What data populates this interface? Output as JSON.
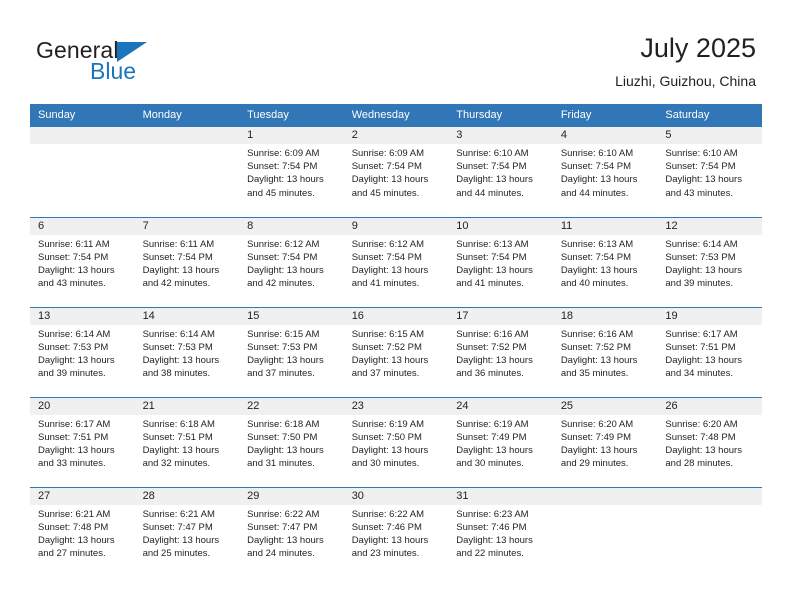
{
  "brand": {
    "name_top": "General",
    "name_bottom": "Blue",
    "triangle_icon": "blue-triangle-logo-icon",
    "color_primary": "#1b75bc",
    "color_text": "#231f20"
  },
  "header": {
    "title": "July 2025",
    "subtitle": "Liuzhi, Guizhou, China"
  },
  "theme": {
    "header_row_bg": "#3176b6",
    "date_band_bg": "#f0f0f0",
    "grid_line": "#3176b6",
    "page_bg": "#ffffff"
  },
  "weekday_headers": [
    "Sunday",
    "Monday",
    "Tuesday",
    "Wednesday",
    "Thursday",
    "Friday",
    "Saturday"
  ],
  "labels": {
    "sunrise_prefix": "Sunrise:",
    "sunset_prefix": "Sunset:",
    "daylight_prefix": "Daylight:"
  },
  "weeks": [
    [
      {
        "date": "",
        "empty": true,
        "sunrise": "",
        "sunset": "",
        "daylight_line1": "",
        "daylight_line2": ""
      },
      {
        "date": "",
        "empty": true,
        "sunrise": "",
        "sunset": "",
        "daylight_line1": "",
        "daylight_line2": ""
      },
      {
        "date": "1",
        "empty": false,
        "sunrise": "Sunrise: 6:09 AM",
        "sunset": "Sunset: 7:54 PM",
        "daylight_line1": "Daylight: 13 hours",
        "daylight_line2": "and 45 minutes."
      },
      {
        "date": "2",
        "empty": false,
        "sunrise": "Sunrise: 6:09 AM",
        "sunset": "Sunset: 7:54 PM",
        "daylight_line1": "Daylight: 13 hours",
        "daylight_line2": "and 45 minutes."
      },
      {
        "date": "3",
        "empty": false,
        "sunrise": "Sunrise: 6:10 AM",
        "sunset": "Sunset: 7:54 PM",
        "daylight_line1": "Daylight: 13 hours",
        "daylight_line2": "and 44 minutes."
      },
      {
        "date": "4",
        "empty": false,
        "sunrise": "Sunrise: 6:10 AM",
        "sunset": "Sunset: 7:54 PM",
        "daylight_line1": "Daylight: 13 hours",
        "daylight_line2": "and 44 minutes."
      },
      {
        "date": "5",
        "empty": false,
        "sunrise": "Sunrise: 6:10 AM",
        "sunset": "Sunset: 7:54 PM",
        "daylight_line1": "Daylight: 13 hours",
        "daylight_line2": "and 43 minutes."
      }
    ],
    [
      {
        "date": "6",
        "empty": false,
        "sunrise": "Sunrise: 6:11 AM",
        "sunset": "Sunset: 7:54 PM",
        "daylight_line1": "Daylight: 13 hours",
        "daylight_line2": "and 43 minutes."
      },
      {
        "date": "7",
        "empty": false,
        "sunrise": "Sunrise: 6:11 AM",
        "sunset": "Sunset: 7:54 PM",
        "daylight_line1": "Daylight: 13 hours",
        "daylight_line2": "and 42 minutes."
      },
      {
        "date": "8",
        "empty": false,
        "sunrise": "Sunrise: 6:12 AM",
        "sunset": "Sunset: 7:54 PM",
        "daylight_line1": "Daylight: 13 hours",
        "daylight_line2": "and 42 minutes."
      },
      {
        "date": "9",
        "empty": false,
        "sunrise": "Sunrise: 6:12 AM",
        "sunset": "Sunset: 7:54 PM",
        "daylight_line1": "Daylight: 13 hours",
        "daylight_line2": "and 41 minutes."
      },
      {
        "date": "10",
        "empty": false,
        "sunrise": "Sunrise: 6:13 AM",
        "sunset": "Sunset: 7:54 PM",
        "daylight_line1": "Daylight: 13 hours",
        "daylight_line2": "and 41 minutes."
      },
      {
        "date": "11",
        "empty": false,
        "sunrise": "Sunrise: 6:13 AM",
        "sunset": "Sunset: 7:54 PM",
        "daylight_line1": "Daylight: 13 hours",
        "daylight_line2": "and 40 minutes."
      },
      {
        "date": "12",
        "empty": false,
        "sunrise": "Sunrise: 6:14 AM",
        "sunset": "Sunset: 7:53 PM",
        "daylight_line1": "Daylight: 13 hours",
        "daylight_line2": "and 39 minutes."
      }
    ],
    [
      {
        "date": "13",
        "empty": false,
        "sunrise": "Sunrise: 6:14 AM",
        "sunset": "Sunset: 7:53 PM",
        "daylight_line1": "Daylight: 13 hours",
        "daylight_line2": "and 39 minutes."
      },
      {
        "date": "14",
        "empty": false,
        "sunrise": "Sunrise: 6:14 AM",
        "sunset": "Sunset: 7:53 PM",
        "daylight_line1": "Daylight: 13 hours",
        "daylight_line2": "and 38 minutes."
      },
      {
        "date": "15",
        "empty": false,
        "sunrise": "Sunrise: 6:15 AM",
        "sunset": "Sunset: 7:53 PM",
        "daylight_line1": "Daylight: 13 hours",
        "daylight_line2": "and 37 minutes."
      },
      {
        "date": "16",
        "empty": false,
        "sunrise": "Sunrise: 6:15 AM",
        "sunset": "Sunset: 7:52 PM",
        "daylight_line1": "Daylight: 13 hours",
        "daylight_line2": "and 37 minutes."
      },
      {
        "date": "17",
        "empty": false,
        "sunrise": "Sunrise: 6:16 AM",
        "sunset": "Sunset: 7:52 PM",
        "daylight_line1": "Daylight: 13 hours",
        "daylight_line2": "and 36 minutes."
      },
      {
        "date": "18",
        "empty": false,
        "sunrise": "Sunrise: 6:16 AM",
        "sunset": "Sunset: 7:52 PM",
        "daylight_line1": "Daylight: 13 hours",
        "daylight_line2": "and 35 minutes."
      },
      {
        "date": "19",
        "empty": false,
        "sunrise": "Sunrise: 6:17 AM",
        "sunset": "Sunset: 7:51 PM",
        "daylight_line1": "Daylight: 13 hours",
        "daylight_line2": "and 34 minutes."
      }
    ],
    [
      {
        "date": "20",
        "empty": false,
        "sunrise": "Sunrise: 6:17 AM",
        "sunset": "Sunset: 7:51 PM",
        "daylight_line1": "Daylight: 13 hours",
        "daylight_line2": "and 33 minutes."
      },
      {
        "date": "21",
        "empty": false,
        "sunrise": "Sunrise: 6:18 AM",
        "sunset": "Sunset: 7:51 PM",
        "daylight_line1": "Daylight: 13 hours",
        "daylight_line2": "and 32 minutes."
      },
      {
        "date": "22",
        "empty": false,
        "sunrise": "Sunrise: 6:18 AM",
        "sunset": "Sunset: 7:50 PM",
        "daylight_line1": "Daylight: 13 hours",
        "daylight_line2": "and 31 minutes."
      },
      {
        "date": "23",
        "empty": false,
        "sunrise": "Sunrise: 6:19 AM",
        "sunset": "Sunset: 7:50 PM",
        "daylight_line1": "Daylight: 13 hours",
        "daylight_line2": "and 30 minutes."
      },
      {
        "date": "24",
        "empty": false,
        "sunrise": "Sunrise: 6:19 AM",
        "sunset": "Sunset: 7:49 PM",
        "daylight_line1": "Daylight: 13 hours",
        "daylight_line2": "and 30 minutes."
      },
      {
        "date": "25",
        "empty": false,
        "sunrise": "Sunrise: 6:20 AM",
        "sunset": "Sunset: 7:49 PM",
        "daylight_line1": "Daylight: 13 hours",
        "daylight_line2": "and 29 minutes."
      },
      {
        "date": "26",
        "empty": false,
        "sunrise": "Sunrise: 6:20 AM",
        "sunset": "Sunset: 7:48 PM",
        "daylight_line1": "Daylight: 13 hours",
        "daylight_line2": "and 28 minutes."
      }
    ],
    [
      {
        "date": "27",
        "empty": false,
        "sunrise": "Sunrise: 6:21 AM",
        "sunset": "Sunset: 7:48 PM",
        "daylight_line1": "Daylight: 13 hours",
        "daylight_line2": "and 27 minutes."
      },
      {
        "date": "28",
        "empty": false,
        "sunrise": "Sunrise: 6:21 AM",
        "sunset": "Sunset: 7:47 PM",
        "daylight_line1": "Daylight: 13 hours",
        "daylight_line2": "and 25 minutes."
      },
      {
        "date": "29",
        "empty": false,
        "sunrise": "Sunrise: 6:22 AM",
        "sunset": "Sunset: 7:47 PM",
        "daylight_line1": "Daylight: 13 hours",
        "daylight_line2": "and 24 minutes."
      },
      {
        "date": "30",
        "empty": false,
        "sunrise": "Sunrise: 6:22 AM",
        "sunset": "Sunset: 7:46 PM",
        "daylight_line1": "Daylight: 13 hours",
        "daylight_line2": "and 23 minutes."
      },
      {
        "date": "31",
        "empty": false,
        "sunrise": "Sunrise: 6:23 AM",
        "sunset": "Sunset: 7:46 PM",
        "daylight_line1": "Daylight: 13 hours",
        "daylight_line2": "and 22 minutes."
      },
      {
        "date": "",
        "empty": true,
        "sunrise": "",
        "sunset": "",
        "daylight_line1": "",
        "daylight_line2": ""
      },
      {
        "date": "",
        "empty": true,
        "sunrise": "",
        "sunset": "",
        "daylight_line1": "",
        "daylight_line2": ""
      }
    ]
  ]
}
